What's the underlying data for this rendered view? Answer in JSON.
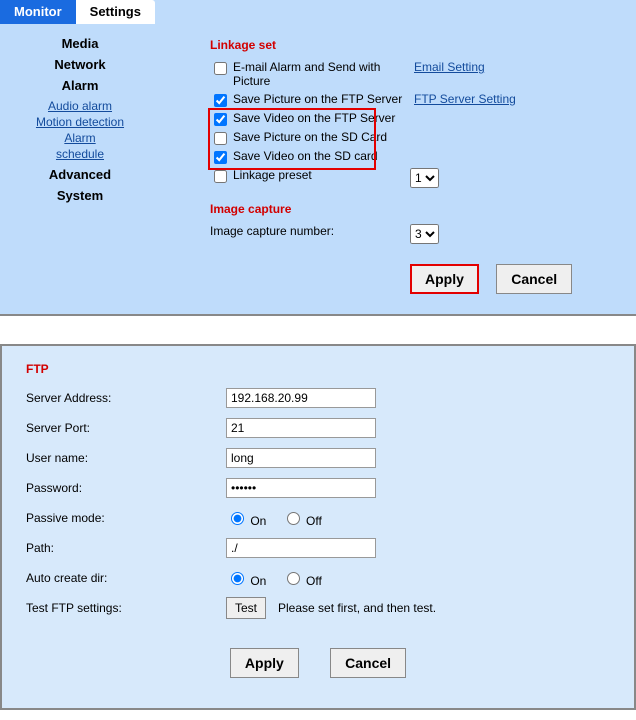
{
  "tabs": {
    "monitor": "Monitor",
    "settings": "Settings"
  },
  "sidebar": {
    "media": "Media",
    "network": "Network",
    "alarm": "Alarm",
    "alarm_items": [
      "Audio alarm",
      "Motion detection",
      "Alarm",
      "schedule"
    ],
    "advanced": "Advanced",
    "system": "System"
  },
  "linkage": {
    "title": "Linkage set",
    "email": "E-mail Alarm and Send with Picture",
    "email_link": "Email Setting",
    "ftp_pic": "Save Picture on the FTP Server",
    "ftp_link": "FTP Server Setting",
    "ftp_vid": "Save Video on the FTP Server",
    "sd_pic": "Save Picture on the SD Card",
    "sd_vid": "Save Video on the SD card",
    "preset": "Linkage preset",
    "preset_val": "1"
  },
  "capture": {
    "title": "Image capture",
    "label": "Image capture number:",
    "val": "3"
  },
  "buttons": {
    "apply": "Apply",
    "cancel": "Cancel",
    "test": "Test"
  },
  "ftp": {
    "title": "FTP",
    "server_address_l": "Server Address:",
    "server_address": "192.168.20.99",
    "server_port_l": "Server Port:",
    "server_port": "21",
    "user_l": "User name:",
    "user": "long",
    "pass_l": "Password:",
    "pass": "••••••",
    "passive_l": "Passive mode:",
    "on": "On",
    "off": "Off",
    "path_l": "Path:",
    "path": "./",
    "auto_l": "Auto create dir:",
    "test_l": "Test FTP settings:",
    "test_msg": "Please set first, and then test."
  }
}
